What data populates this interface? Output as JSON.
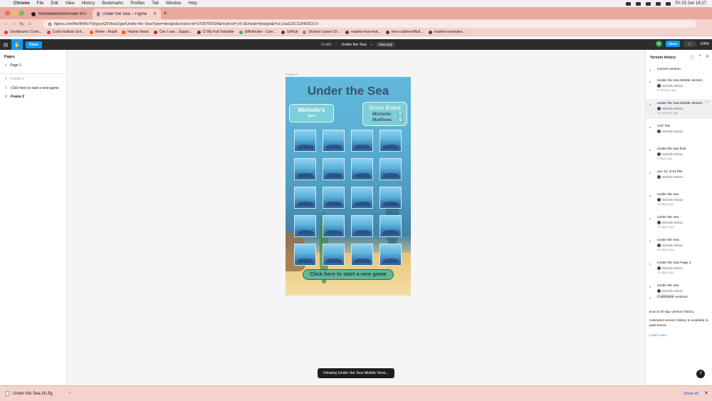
{
  "menubar": {
    "app": "Chrome",
    "items": [
      "File",
      "Edit",
      "View",
      "History",
      "Bookmarks",
      "Profiles",
      "Tab",
      "Window",
      "Help"
    ],
    "clock": "Fri 23 Jun  16:17"
  },
  "tabs": [
    {
      "title": "MichelleBritton/under-the-sea",
      "active": false
    },
    {
      "title": "Under the Sea – Figma",
      "active": true
    }
  ],
  "address": {
    "url": "figma.com/file/RlWv7VjrgxyrQ0VkwZzgw/Under-the-Sea?type=design&version-id=3705705634&node-id=14-2&mode=design&t=cLUuaIZZC1DNN3C6-0"
  },
  "bookmarks": [
    "Dashboard | Code...",
    "Code Institute Sch...",
    "Home - Replit",
    "Hacker News",
    "Can I use... Suppo...",
    "CI My Full Template",
    "Diffchecker - Com...",
    "GitHub",
    "Division Game Ch...",
    "readme-love-mat...",
    "kera-cudmore/Bull...",
    "readme-examples..."
  ],
  "figma": {
    "done_label": "Done",
    "drafts": "Drafts",
    "separator": "/",
    "file_name": "Under the Sea",
    "view_only": "View only",
    "avatar_letter": "M",
    "share_label": "Share",
    "zoom": "100%"
  },
  "left_panel": {
    "pages_heading": "Pages",
    "pages": [
      "Page 1"
    ],
    "layers": [
      {
        "label": "Frame 1",
        "icon": "#",
        "dim": true
      },
      {
        "label": "Click here to start a new game",
        "icon": "T",
        "dim": false
      },
      {
        "label": "Frame 2",
        "icon": "#",
        "bold": true
      }
    ]
  },
  "canvas": {
    "frame_label": "Frame 2",
    "game": {
      "title": "Under the Sea",
      "turn_name": "Michelle's",
      "turn_label": "turn",
      "score_heading": "Score Board",
      "scores": [
        {
          "name": "Michelle:",
          "value": "0"
        },
        {
          "name": "Matthew:",
          "value": "0"
        }
      ],
      "card_rows": 5,
      "card_cols": 4,
      "start_button": "Click here to start a new game"
    },
    "toast": "Viewing Under the Sea Mobile Versi..."
  },
  "version_history": {
    "heading": "Version history",
    "current": "Current version",
    "versions": [
      {
        "title": "Under the Sea Mobile Version",
        "user": "Michelle Britton",
        "time": "8 minutes ago",
        "selected": false
      },
      {
        "title": "Under the Sea Mobile Version",
        "user": "Michelle Britton",
        "time": "10 minutes ago",
        "selected": true
      },
      {
        "title": "3:57 PM",
        "user": "Michelle Britton",
        "time": "",
        "selected": false
      },
      {
        "title": "Under the sea final",
        "user": "Michelle Britton",
        "time": "5 days ago",
        "selected": false
      },
      {
        "title": "Jun 12, 8:31 PM",
        "user": "Michelle Britton",
        "time": "",
        "selected": false
      },
      {
        "title": "Under the sea",
        "user": "Michelle Britton",
        "time": "11 days ago",
        "selected": false
      },
      {
        "title": "Under the sea",
        "user": "Michelle Britton",
        "time": "11 days ago",
        "selected": false
      },
      {
        "title": "Under the Sea",
        "user": "Michelle Britton",
        "time": "11 days ago",
        "selected": false
      },
      {
        "title": "Under the Sea Page 2",
        "user": "Michelle Britton",
        "time": "11 days ago",
        "selected": false
      },
      {
        "title": "Under the sea",
        "user": "Michelle Britton",
        "time": "11 days ago",
        "selected": false
      }
    ],
    "autosave": "2 autosave versions",
    "footer1": "End of 30-day version history.",
    "footer2": "Unlimited version history is available to paid teams.",
    "learn_more": "Learn more"
  },
  "download": {
    "file": "Under the Sea (4).fig",
    "show_all": "Show all"
  },
  "colors": {
    "figma_blue": "#0d99ff",
    "tabstrip": "#e8a9a0",
    "toolbar": "#f6d2cc"
  }
}
